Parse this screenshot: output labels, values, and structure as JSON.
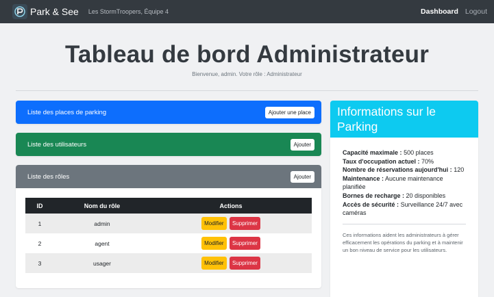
{
  "navbar": {
    "brand": "Park & See",
    "team": "Les StormTroopers, Équipe 4",
    "links": {
      "dashboard": "Dashboard",
      "logout": "Logout"
    }
  },
  "header": {
    "title": "Tableau de bord Administrateur",
    "welcome": "Bienvenue, admin. Votre rôle : Administrateur"
  },
  "sections": {
    "parking": {
      "label": "Liste des places de parking",
      "button": "Ajouter une place"
    },
    "users": {
      "label": "Liste des utilisateurs",
      "button": "Ajouter"
    },
    "roles": {
      "label": "Liste des rôles",
      "button": "Ajouter"
    }
  },
  "roles_table": {
    "headers": {
      "id": "ID",
      "name": "Nom du rôle",
      "actions": "Actions"
    },
    "rows": [
      {
        "id": "1",
        "name": "admin"
      },
      {
        "id": "2",
        "name": "agent"
      },
      {
        "id": "3",
        "name": "usager"
      }
    ],
    "edit_label": "Modifier",
    "delete_label": "Supprimer"
  },
  "info": {
    "title": "Informations sur le Parking",
    "capacity": {
      "label": "Capacité maximale :",
      "value": "500 places"
    },
    "occupancy": {
      "label": "Taux d'occupation actuel :",
      "value": "70%"
    },
    "reservations": {
      "label": "Nombre de réservations aujourd'hui :",
      "value": "120"
    },
    "maintenance": {
      "label": "Maintenance :",
      "value": "Aucune maintenance planifiée"
    },
    "charging": {
      "label": "Bornes de recharge :",
      "value": "20 disponibles"
    },
    "security": {
      "label": "Accès de sécurité :",
      "value": "Surveillance 24/7 avec caméras"
    },
    "note": "Ces informations aident les administrateurs à gérer efficacement les opérations du parking et à maintenir un bon niveau de service pour les utilisateurs."
  },
  "colors": {
    "navbar": "#343a40",
    "primary": "#0d6efd",
    "success": "#198754",
    "secondary": "#6c757d",
    "info": "#0dcaf0",
    "warning": "#ffc107",
    "danger": "#dc3545"
  },
  "icons": {
    "logo": "parking-logo-icon"
  }
}
